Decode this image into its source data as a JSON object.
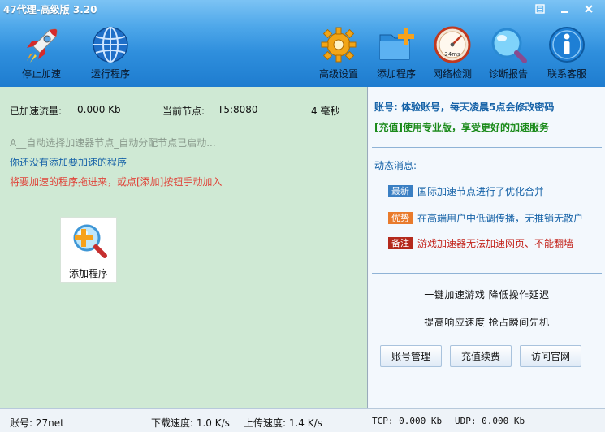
{
  "window": {
    "title": "47代理-高级版 3.20"
  },
  "toolbar": {
    "stop": "停止加速",
    "run": "运行程序",
    "settings": "高级设置",
    "add": "添加程序",
    "network": "网络检测",
    "diagnose": "诊断报告",
    "support": "联系客服",
    "gauge_text": "24ms"
  },
  "left": {
    "traffic_label": "已加速流量:",
    "traffic_value": "0.000 Kb",
    "node_label": "当前节点:",
    "node_value": "T5:8080",
    "latency": "4 毫秒",
    "hint_auto": "A__自动选择加速器节点_自动分配节点已启动...",
    "hint_none": "你还没有添加要加速的程序",
    "hint_drag": "将要加速的程序拖进来，或点[添加]按钮手动加入",
    "add_tile": "添加程序"
  },
  "right": {
    "account_line": "账号:  体验账号，每天凌晨5点会修改密码",
    "vip_line": "[充值]使用专业版，享受更好的加速服务",
    "news_title": "动态消息:",
    "news": [
      {
        "badge": "最新",
        "color": "#3a7fc3",
        "text": "国际加速节点进行了优化合并",
        "text_color": "#1763a8"
      },
      {
        "badge": "优势",
        "color": "#e97b2c",
        "text": "在高端用户中低调传播，无推销无散户",
        "text_color": "#1763a8"
      },
      {
        "badge": "备注",
        "color": "#b42a1c",
        "text": "游戏加速器无法加速网页、不能翻墙",
        "text_color": "#c3221a"
      }
    ],
    "slogan1": "一键加速游戏  降低操作延迟",
    "slogan2": "提高响应速度  抢占瞬间先机",
    "btn_account": "账号管理",
    "btn_recharge": "充值续费",
    "btn_site": "访问官网"
  },
  "status": {
    "account": "账号: 27net",
    "download": "下载速度: 1.0 K/s",
    "upload": "上传速度: 1.4 K/s",
    "tcp": "TCP: 0.000 Kb",
    "udp": "UDP: 0.000 Kb"
  },
  "colors": {
    "hint_auto": "#8a9a8d",
    "hint_none": "#1763a8",
    "hint_drag": "#e0443a"
  }
}
